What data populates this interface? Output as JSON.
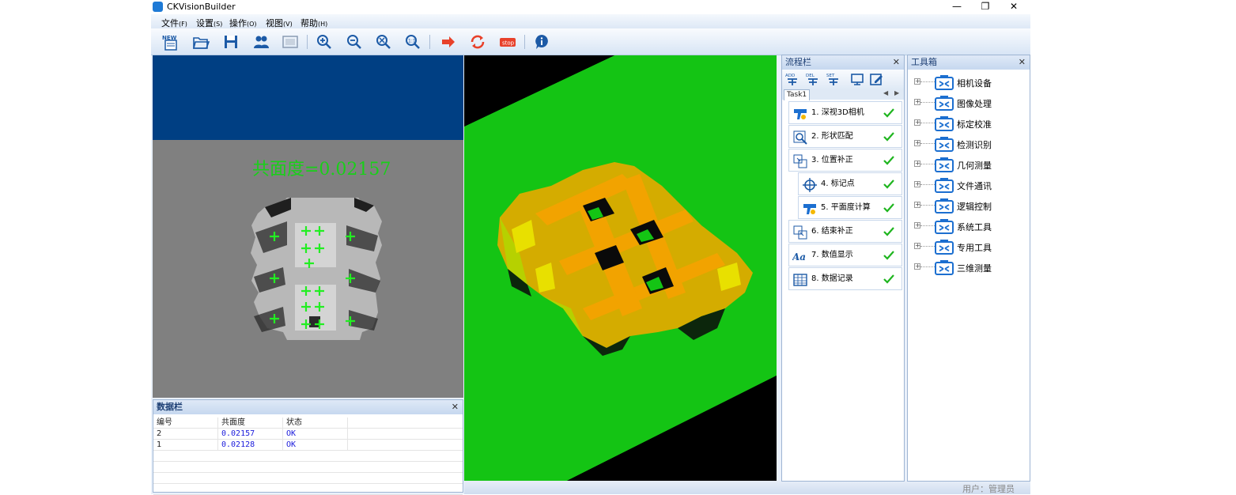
{
  "app": {
    "title": "CKVisionBuilder"
  },
  "window": {
    "minimize": "—",
    "restore": "❐",
    "close": "✕"
  },
  "menu": [
    {
      "label": "文件",
      "key": "(F)"
    },
    {
      "label": "设置",
      "key": "(S)"
    },
    {
      "label": "操作",
      "key": "(O)"
    },
    {
      "label": "视图",
      "key": "(V)"
    },
    {
      "label": "帮助",
      "key": "(H)"
    }
  ],
  "toolbar": [
    {
      "name": "new-icon",
      "label": "NEW"
    },
    {
      "name": "open-folder-icon"
    },
    {
      "name": "save-icon"
    },
    {
      "name": "users-icon"
    },
    {
      "name": "screen-icon"
    },
    {
      "name": "zoom-in-icon"
    },
    {
      "name": "zoom-out-icon"
    },
    {
      "name": "zoom-fit-icon"
    },
    {
      "name": "zoom-actual-icon"
    },
    {
      "name": "run-once-icon"
    },
    {
      "name": "run-loop-icon"
    },
    {
      "name": "stop-icon",
      "label": "stop"
    },
    {
      "name": "help-icon"
    }
  ],
  "image_view": {
    "overlay_text": "共面度=0.02157"
  },
  "data_panel": {
    "title": "数据栏",
    "close": "✕",
    "columns": [
      "编号",
      "共面度",
      "状态"
    ],
    "rows": [
      [
        "2",
        "0.02157",
        "OK"
      ],
      [
        "1",
        "0.02128",
        "OK"
      ]
    ]
  },
  "flow_panel": {
    "title": "流程栏",
    "close": "✕",
    "tools": [
      "ADD",
      "DEL",
      "SET",
      "display-icon",
      "edit-icon"
    ],
    "tab": "Task1",
    "items": [
      {
        "label": "1. 深视3D相机",
        "status": "ok"
      },
      {
        "label": "2. 形状匹配",
        "status": "ok"
      },
      {
        "label": "3. 位置补正",
        "status": "ok"
      },
      {
        "label": "4. 标记点",
        "status": "ok",
        "sub": true
      },
      {
        "label": "5. 平面度计算",
        "status": "ok",
        "sub": true
      },
      {
        "label": "6. 结束补正",
        "status": "ok"
      },
      {
        "label": "7. 数值显示",
        "status": "ok"
      },
      {
        "label": "8. 数据记录",
        "status": "ok"
      }
    ]
  },
  "tool_panel": {
    "title": "工具箱",
    "close": "✕",
    "items": [
      "相机设备",
      "图像处理",
      "标定校准",
      "检测识别",
      "几何测量",
      "文件通讯",
      "逻辑控制",
      "系统工具",
      "专用工具",
      "三维测量"
    ]
  },
  "status_bar": {
    "user": "用户：管理员"
  },
  "colors": {
    "accent": "#1e7ad6",
    "ok": "#1fb51f",
    "overlay": "#18d018",
    "stop": "#e8412a"
  }
}
